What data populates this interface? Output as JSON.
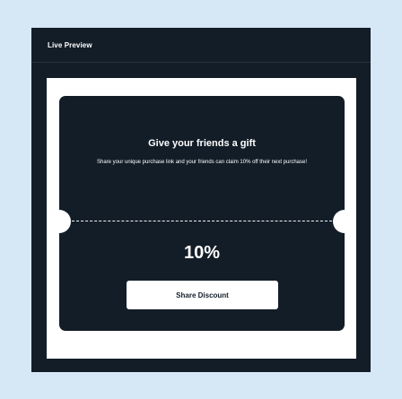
{
  "panel": {
    "title": "Live Preview"
  },
  "coupon": {
    "headline": "Give your friends a gift",
    "subtext": "Share your unique purchase link and your friends can claim 10% off their next purchase!",
    "discount": "10%",
    "button_label": "Share Discount"
  },
  "colors": {
    "page_background": "#d6e8f6",
    "panel_background": "#131d28",
    "preview_background": "#ffffff",
    "coupon_background": "#131d28",
    "text_on_dark": "#ffffff"
  }
}
